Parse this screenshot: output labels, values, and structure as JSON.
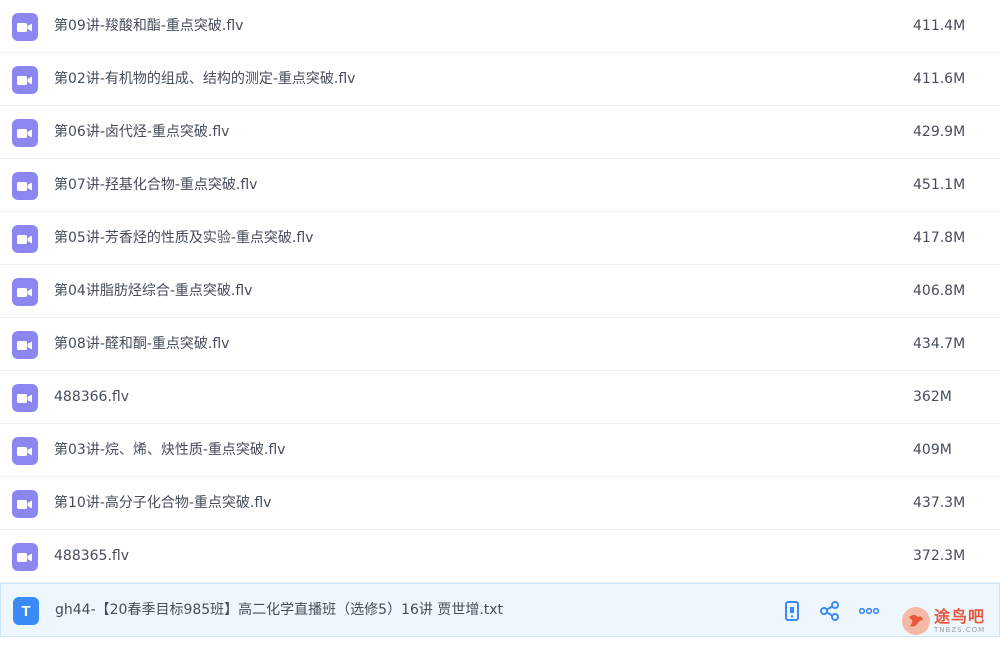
{
  "files": [
    {
      "name": "第09讲-羧酸和酯-重点突破.flv",
      "size": "411.4M",
      "type": "video"
    },
    {
      "name": "第02讲-有机物的组成、结构的测定-重点突破.flv",
      "size": "411.6M",
      "type": "video"
    },
    {
      "name": "第06讲-卤代烃-重点突破.flv",
      "size": "429.9M",
      "type": "video"
    },
    {
      "name": "第07讲-羟基化合物-重点突破.flv",
      "size": "451.1M",
      "type": "video"
    },
    {
      "name": "第05讲-芳香烃的性质及实验-重点突破.flv",
      "size": "417.8M",
      "type": "video"
    },
    {
      "name": "第04讲脂肪烃综合-重点突破.flv",
      "size": "406.8M",
      "type": "video"
    },
    {
      "name": "第08讲-醛和酮-重点突破.flv",
      "size": "434.7M",
      "type": "video"
    },
    {
      "name": "488366.flv",
      "size": "362M",
      "type": "video"
    },
    {
      "name": "第03讲-烷、烯、炔性质-重点突破.flv",
      "size": "409M",
      "type": "video"
    },
    {
      "name": "第10讲-高分子化合物-重点突破.flv",
      "size": "437.3M",
      "type": "video"
    },
    {
      "name": "488365.flv",
      "size": "372.3M",
      "type": "video"
    }
  ],
  "selected_file": {
    "name": "gh44-【20春季目标985班】高二化学直播班（选修5）16讲 贾世增.txt",
    "type": "text",
    "icon_letter": "T"
  },
  "row_actions": [
    "phone-icon",
    "share-icon",
    "more-icon"
  ],
  "watermark": {
    "main": "途鸟吧",
    "sub": "TNBZS.COM"
  },
  "colors": {
    "video_icon": "#8b86f0",
    "text_icon": "#3a8bf6",
    "action": "#3a8bf6",
    "selected_bg": "#eef7fe"
  }
}
